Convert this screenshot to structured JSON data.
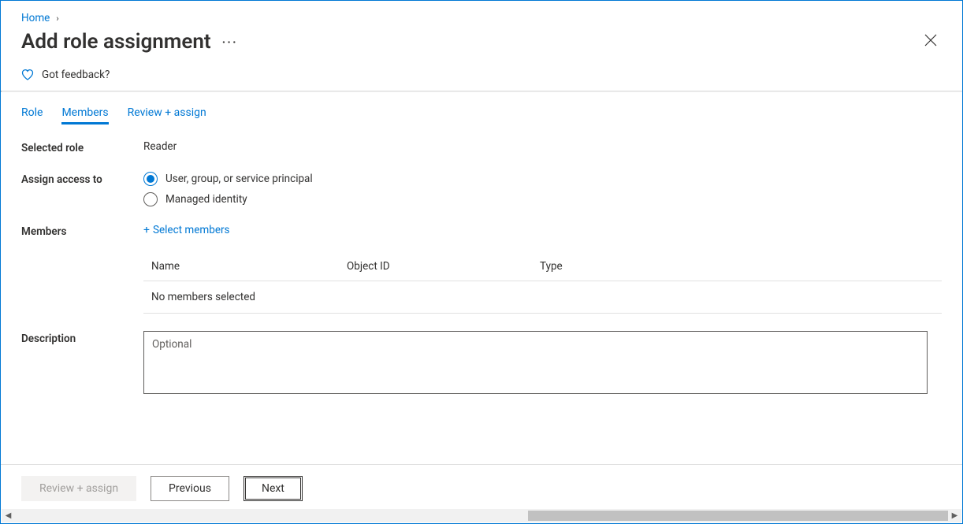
{
  "breadcrumb": {
    "home": "Home"
  },
  "title": "Add role assignment",
  "feedback_label": "Got feedback?",
  "tabs": {
    "role": "Role",
    "members": "Members",
    "review": "Review + assign"
  },
  "form": {
    "selected_role_label": "Selected role",
    "selected_role_value": "Reader",
    "assign_access_label": "Assign access to",
    "assign_options": {
      "user_group": "User, group, or service principal",
      "managed_identity": "Managed identity"
    },
    "members_label": "Members",
    "select_members_link": "Select members",
    "table": {
      "name_header": "Name",
      "object_id_header": "Object ID",
      "type_header": "Type",
      "empty_text": "No members selected"
    },
    "description_label": "Description",
    "description_placeholder": "Optional"
  },
  "footer": {
    "review_assign": "Review + assign",
    "previous": "Previous",
    "next": "Next"
  }
}
